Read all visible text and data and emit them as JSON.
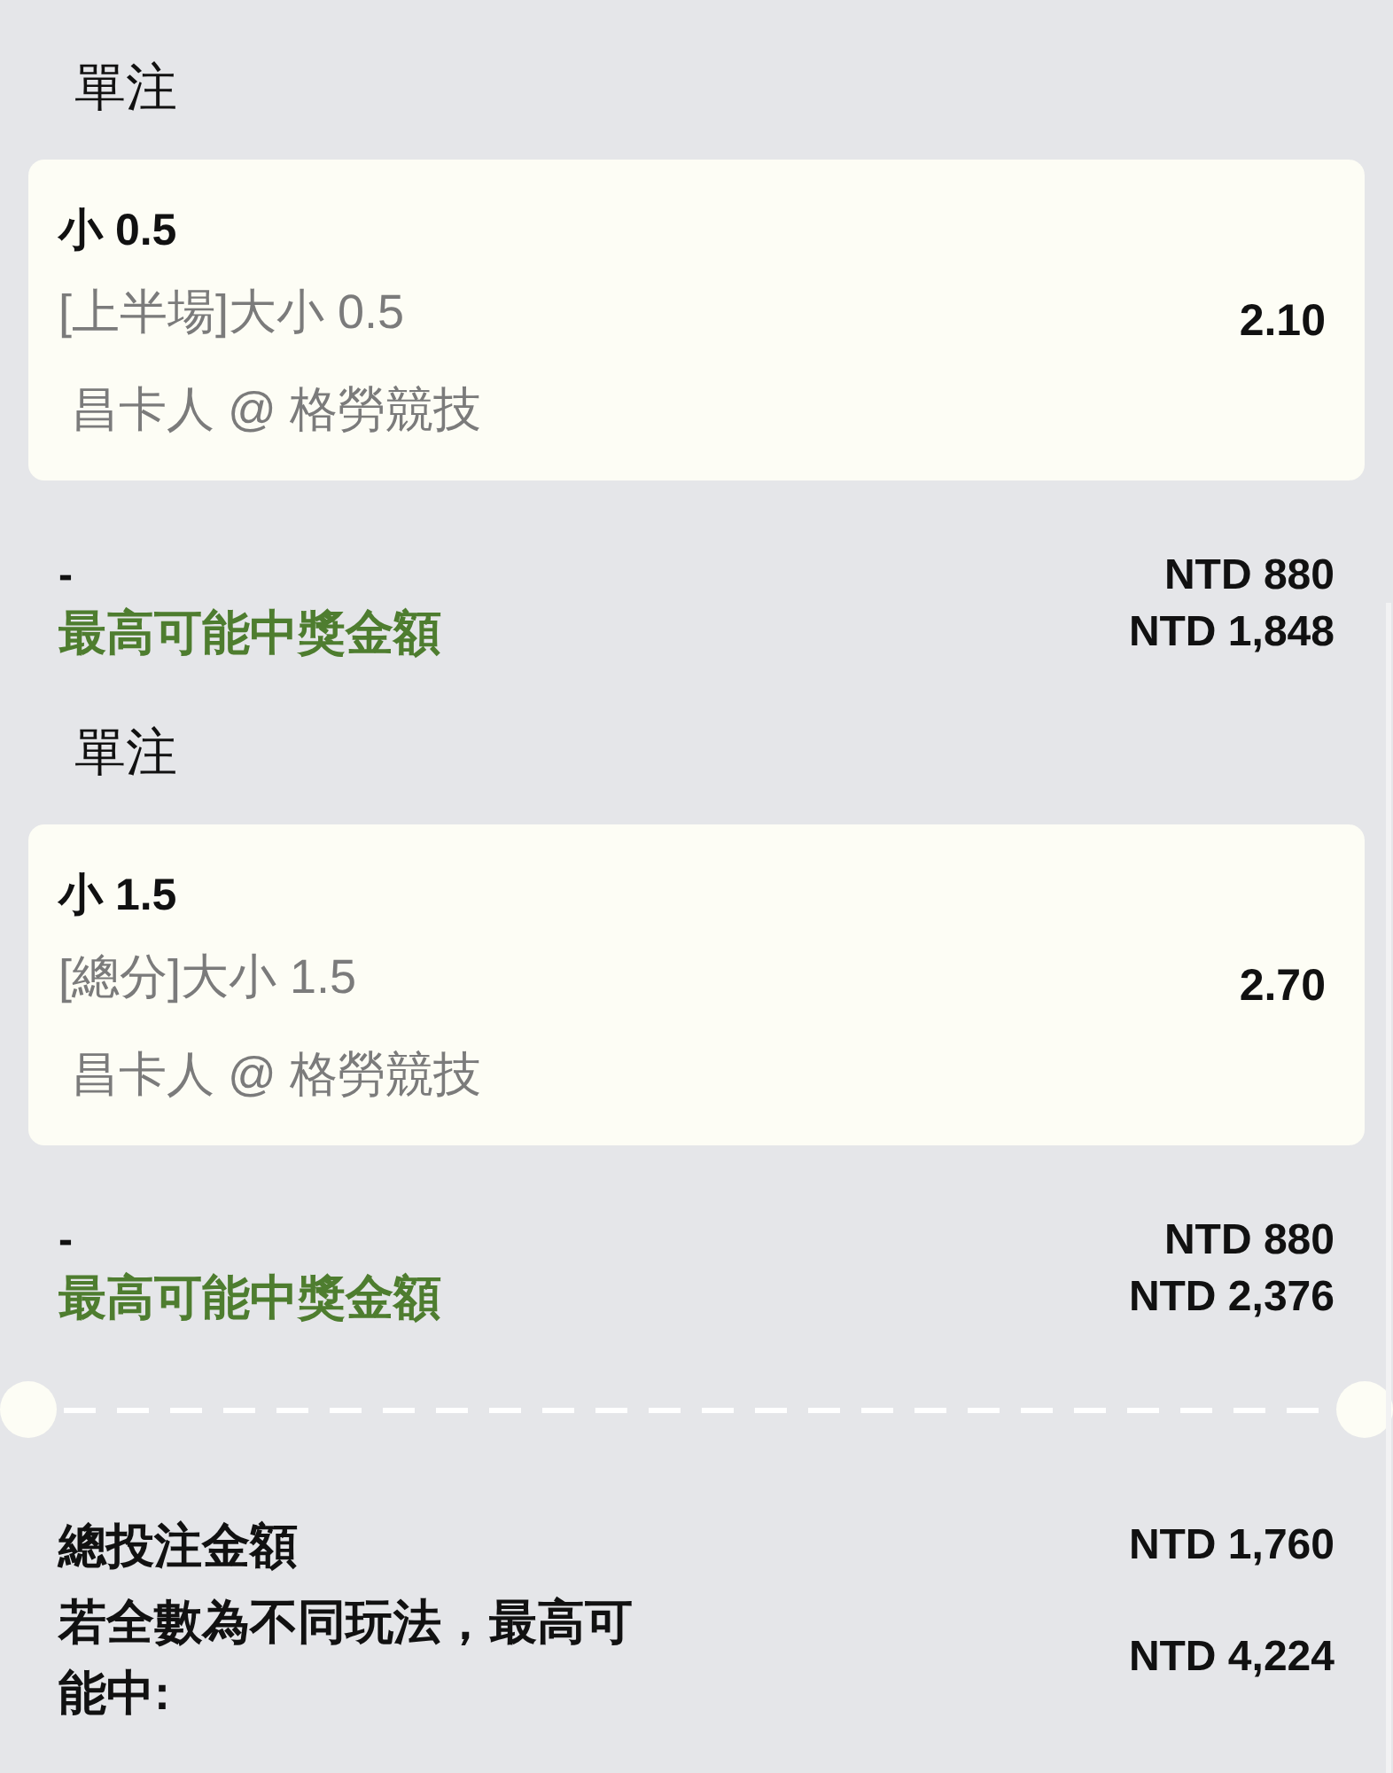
{
  "bets": [
    {
      "heading": "單注",
      "selection": "小 0.5",
      "market": "[上半場]大小 0.5",
      "match": "昌卡人 @ 格勞競技",
      "odds": "2.10",
      "stake_label": "-",
      "stake": "NTD 880",
      "payout_label": "最高可能中獎金額",
      "payout": "NTD 1,848"
    },
    {
      "heading": "單注",
      "selection": "小 1.5",
      "market": "[總分]大小 1.5",
      "match": "昌卡人 @ 格勞競技",
      "odds": "2.70",
      "stake_label": "-",
      "stake": "NTD 880",
      "payout_label": "最高可能中獎金額",
      "payout": "NTD 2,376"
    }
  ],
  "totals": {
    "stake_label": "總投注金額",
    "stake": "NTD 1,760",
    "payout_label": "若全數為不同玩法，最高可能中:",
    "payout": "NTD 4,224"
  }
}
